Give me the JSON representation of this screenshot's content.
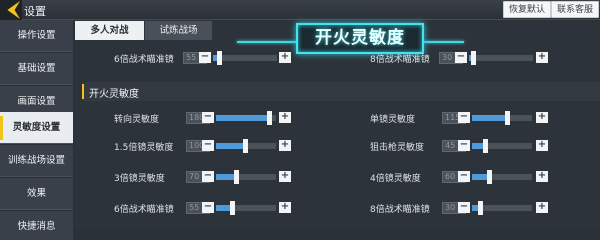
{
  "header": {
    "title": "设置",
    "restore_label": "恢复默认",
    "support_label": "联系客服"
  },
  "sidebar": {
    "items": [
      {
        "label": "操作设置"
      },
      {
        "label": "基础设置"
      },
      {
        "label": "画面设置"
      },
      {
        "label": "灵敏度设置",
        "active": true
      },
      {
        "label": "训练战场设置"
      },
      {
        "label": "效果"
      },
      {
        "label": "快捷消息"
      }
    ]
  },
  "tabs": [
    {
      "label": "多人对战",
      "active": true
    },
    {
      "label": "试炼战场",
      "active": false
    }
  ],
  "banner": {
    "title": "开火灵敏度"
  },
  "top_row": [
    {
      "label": "6倍战术瞄准镜",
      "value": "55",
      "level": 0.55
    },
    {
      "label": "8倍战术瞄准镜",
      "value": "30",
      "level": 0.3
    }
  ],
  "section": {
    "title": "开火灵敏度"
  },
  "sliders": [
    {
      "label": "转向灵敏度",
      "value": "180",
      "level": 0.9
    },
    {
      "label": "单镜灵敏度",
      "value": "115",
      "level": 0.6
    },
    {
      "label": "1.5倍镜灵敏度",
      "value": "100",
      "level": 0.5
    },
    {
      "label": "狙击枪灵敏度",
      "value": "45",
      "level": 0.23
    },
    {
      "label": "3倍镜灵敏度",
      "value": "70",
      "level": 0.35
    },
    {
      "label": "4倍镜灵敏度",
      "value": "60",
      "level": 0.3
    },
    {
      "label": "6倍战术瞄准镜",
      "value": "55",
      "level": 0.28
    },
    {
      "label": "8倍战术瞄准镜",
      "value": "30",
      "level": 0.15
    }
  ],
  "colors": {
    "accent": "#f0c419",
    "slider_fill": "#4f9adb",
    "banner_glow": "#47e1ec"
  }
}
